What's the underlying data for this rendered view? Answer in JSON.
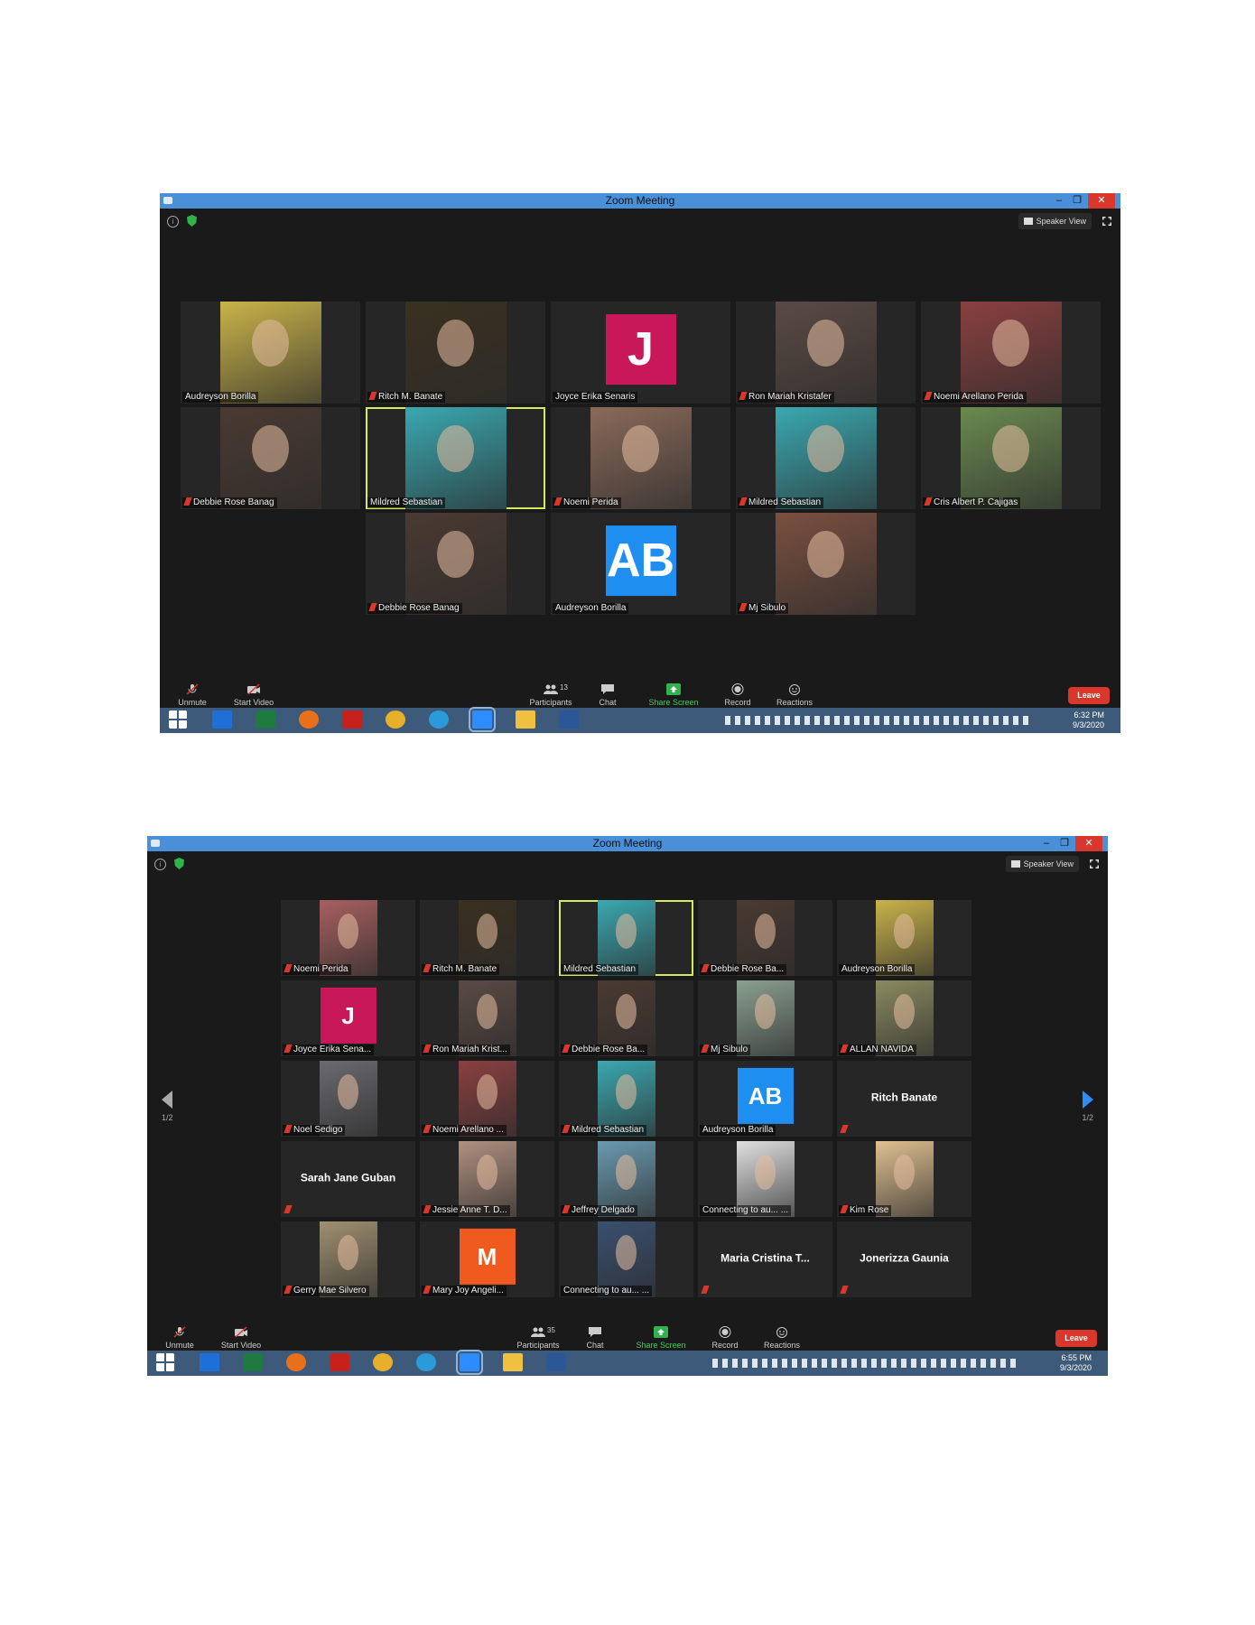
{
  "shot1": {
    "window_title": "Zoom Meeting",
    "speaker_view": "Speaker View",
    "tiles": [
      {
        "name": "Audreyson Borilla",
        "muted": false,
        "kind": "photo",
        "color": "#c9b34a"
      },
      {
        "name": "Ritch M. Banate",
        "muted": true,
        "kind": "photo",
        "color": "#3a3020"
      },
      {
        "name": "Joyce Erika Senaris",
        "muted": false,
        "kind": "avatar",
        "letter": "J",
        "color": "#c8185a"
      },
      {
        "name": "Ron Mariah Kristafer",
        "muted": true,
        "kind": "photo",
        "color": "#5a4a44"
      },
      {
        "name": "Noemi Arellano Perida",
        "muted": true,
        "kind": "photo",
        "color": "#8a4040"
      },
      {
        "name": "Debbie Rose Banag",
        "muted": true,
        "kind": "photo",
        "color": "#4a3a32"
      },
      {
        "name": "Mildred Sebastian",
        "muted": false,
        "kind": "photo",
        "color": "#3aa8b0",
        "active": true
      },
      {
        "name": "Noemi Perida",
        "muted": true,
        "kind": "photo",
        "color": "#8a6a5a"
      },
      {
        "name": "Mildred Sebastian",
        "muted": true,
        "kind": "photo",
        "color": "#3aa8b0"
      },
      {
        "name": "Cris Albert P. Cajigas",
        "muted": true,
        "kind": "photo",
        "color": "#6a8a50"
      },
      {
        "name": "Debbie Rose Banag",
        "muted": true,
        "kind": "photo",
        "color": "#4a3a32"
      },
      {
        "name": "Audreyson Borilla",
        "muted": false,
        "kind": "avatar",
        "letter": "AB",
        "color": "#1e8ff0"
      },
      {
        "name": "Mj Sibulo",
        "muted": true,
        "kind": "photo",
        "color": "#7a5040"
      }
    ],
    "toolbar": {
      "unmute": "Unmute",
      "start_video": "Start Video",
      "participants": "Participants",
      "participants_count": "13",
      "chat": "Chat",
      "share_screen": "Share Screen",
      "record": "Record",
      "reactions": "Reactions",
      "leave": "Leave"
    },
    "clock": {
      "time": "6:32 PM",
      "date": "9/3/2020"
    }
  },
  "shot2": {
    "window_title": "Zoom Meeting",
    "speaker_view": "Speaker View",
    "page_left": "1/2",
    "page_right": "1/2",
    "tiles": [
      {
        "name": "Noemi Perida",
        "muted": true,
        "kind": "photo",
        "color": "#a86060"
      },
      {
        "name": "Ritch M. Banate",
        "muted": true,
        "kind": "photo",
        "color": "#3a3020"
      },
      {
        "name": "Mildred Sebastian",
        "muted": false,
        "kind": "photo",
        "color": "#3aa8b0",
        "active": true
      },
      {
        "name": "Debbie Rose Ba...",
        "muted": true,
        "kind": "photo",
        "color": "#4a3a32"
      },
      {
        "name": "Audreyson Borilla",
        "muted": false,
        "kind": "photo",
        "color": "#c9b34a"
      },
      {
        "name": "Joyce Erika Sena...",
        "muted": true,
        "kind": "avatar",
        "letter": "J",
        "color": "#c8185a"
      },
      {
        "name": "Ron Mariah Krist...",
        "muted": true,
        "kind": "photo",
        "color": "#5a4a44"
      },
      {
        "name": "Debbie Rose Ba...",
        "muted": true,
        "kind": "photo",
        "color": "#4a3a32"
      },
      {
        "name": "Mj Sibulo",
        "muted": true,
        "kind": "photo",
        "color": "#8aa090"
      },
      {
        "name": "ALLAN NAVIDA",
        "muted": true,
        "kind": "photo",
        "color": "#8a8a60"
      },
      {
        "name": "Noel Sedigo",
        "muted": true,
        "kind": "photo",
        "color": "#6a6a70"
      },
      {
        "name": "Noemi Arellano ...",
        "muted": true,
        "kind": "photo",
        "color": "#8a4040"
      },
      {
        "name": "Mildred Sebastian",
        "muted": true,
        "kind": "photo",
        "color": "#3aa8b0"
      },
      {
        "name": "Audreyson Borilla",
        "muted": false,
        "kind": "avatar",
        "letter": "AB",
        "color": "#1e8ff0"
      },
      {
        "name": "",
        "muted": true,
        "kind": "text",
        "big": "Ritch Banate"
      },
      {
        "name": "",
        "muted": true,
        "kind": "text",
        "big": "Sarah Jane Guban"
      },
      {
        "name": "Jessie Anne T. D...",
        "muted": true,
        "kind": "photo",
        "color": "#b09080"
      },
      {
        "name": "Jeffrey Delgado",
        "muted": true,
        "kind": "photo",
        "color": "#6a9ab0"
      },
      {
        "name": "Connecting to au... ...",
        "muted": false,
        "kind": "photo",
        "color": "#e0e0e0"
      },
      {
        "name": "Kim Rose",
        "muted": true,
        "kind": "photo",
        "color": "#e0c090"
      },
      {
        "name": "Gerry Mae Silvero",
        "muted": true,
        "kind": "photo",
        "color": "#a09070"
      },
      {
        "name": "Mary Joy Angeli...",
        "muted": true,
        "kind": "avatar",
        "letter": "M",
        "color": "#f05a1e"
      },
      {
        "name": "Connecting to au... ...",
        "muted": false,
        "kind": "photo",
        "color": "#3a5070"
      },
      {
        "name": "",
        "muted": true,
        "kind": "text",
        "big": "Maria Cristina T..."
      },
      {
        "name": "",
        "muted": true,
        "kind": "text",
        "big": "Jonerizza Gaunia"
      }
    ],
    "toolbar": {
      "unmute": "Unmute",
      "start_video": "Start Video",
      "participants": "Participants",
      "participants_count": "35",
      "chat": "Chat",
      "share_screen": "Share Screen",
      "record": "Record",
      "reactions": "Reactions",
      "leave": "Leave"
    },
    "clock": {
      "time": "6:55 PM",
      "date": "9/3/2020"
    }
  },
  "taskbar_apps": [
    {
      "icon": "windows-start-icon",
      "color": "#ffffff"
    },
    {
      "icon": "maxthon-icon",
      "color": "#1e6fd8"
    },
    {
      "icon": "excel-icon",
      "color": "#1f7a3f"
    },
    {
      "icon": "firefox-icon",
      "color": "#e8701a"
    },
    {
      "icon": "acrobat-icon",
      "color": "#c8201a"
    },
    {
      "icon": "chrome-icon",
      "color": "#e8b02a"
    },
    {
      "icon": "edge-icon",
      "color": "#2a9ad8"
    },
    {
      "icon": "zoom-icon",
      "color": "#2d8cff"
    },
    {
      "icon": "file-explorer-icon",
      "color": "#f0c040"
    },
    {
      "icon": "word-icon",
      "color": "#2b5797"
    }
  ]
}
